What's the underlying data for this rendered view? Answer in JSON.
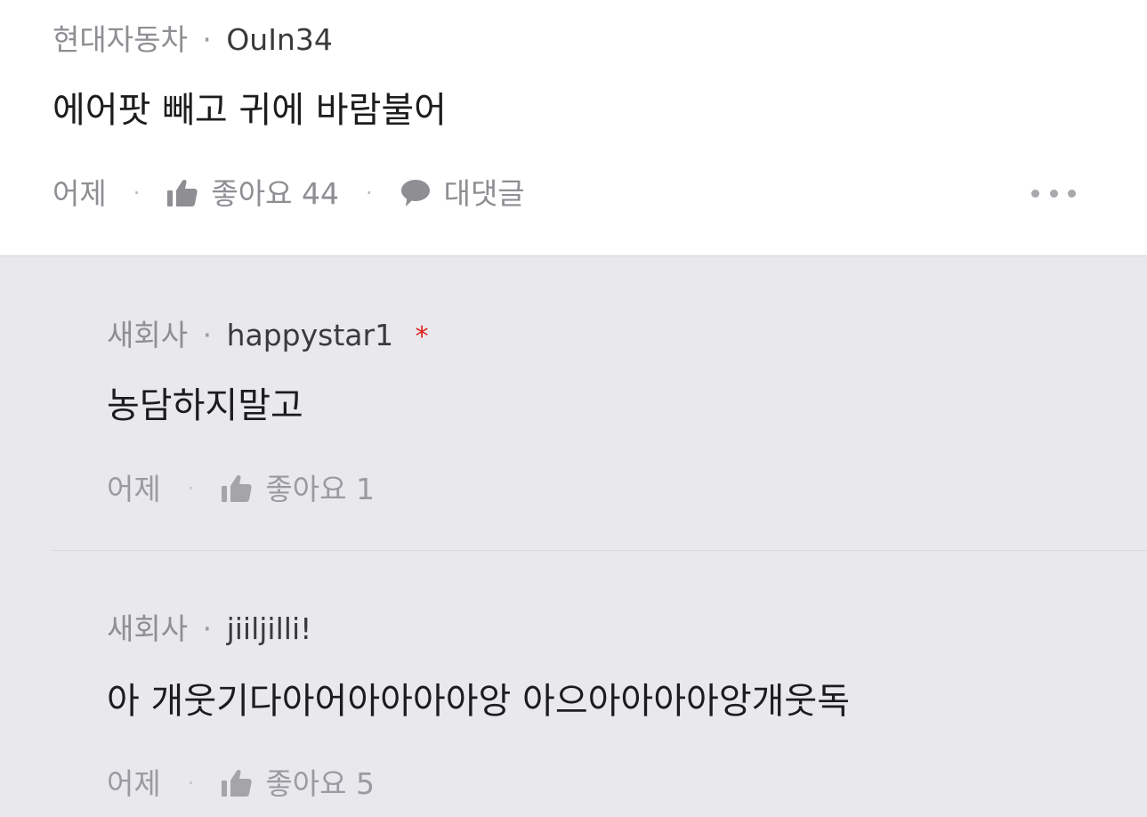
{
  "comment": {
    "company": "현대자동차",
    "separator": "·",
    "nickname": "OuIn34",
    "text": "에어팟 빼고 귀에 바람불어",
    "time": "어제",
    "like_label": "좋아요 44",
    "reply_label": "대댓글",
    "more_icon": "more-horizontal-icon"
  },
  "replies": [
    {
      "company": "새회사",
      "separator": "·",
      "nickname": "happystar1",
      "badge": "*",
      "text": "농담하지말고",
      "time": "어제",
      "like_label": "좋아요 1"
    },
    {
      "company": "새회사",
      "separator": "·",
      "nickname": "jiiljilli!",
      "text": "아 개웃기다아어아아아아앙 아으아아아아앙개웃독",
      "time": "어제",
      "like_label": "좋아요 5"
    }
  ],
  "colors": {
    "background_main": "#ffffff",
    "background_replies": "#e9e9ed",
    "badge": "#e02020",
    "text_primary": "#1c1c1e",
    "text_secondary": "#8e8e93"
  },
  "icons": {
    "like": "thumbs-up-icon",
    "reply": "speech-bubble-icon",
    "more": "more-horizontal-icon"
  }
}
